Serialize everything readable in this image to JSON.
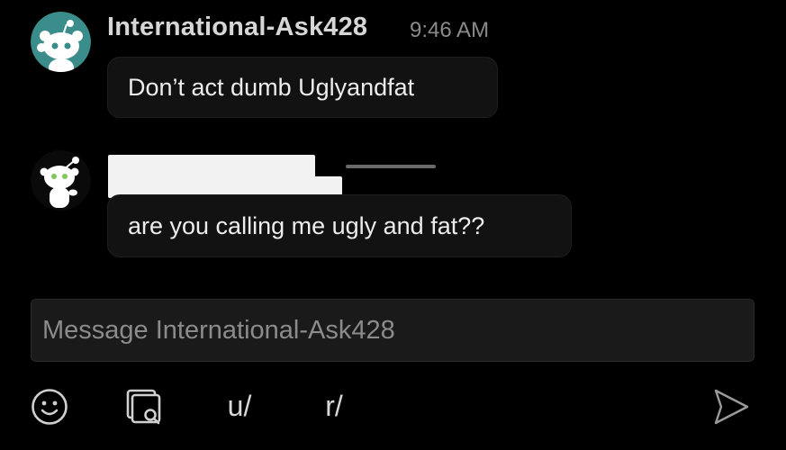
{
  "messages": [
    {
      "username": "International-Ask428",
      "time": "9:46 AM",
      "text": "Don’t act dumb Uglyandfat"
    },
    {
      "username": "",
      "time": "",
      "text": "are you calling me ugly and fat??"
    }
  ],
  "composer": {
    "placeholder": "Message International-Ask428"
  },
  "toolbar": {
    "user_mention_label": "u/",
    "community_mention_label": "r/"
  },
  "colors": {
    "background": "#000000",
    "bubble": "#121212",
    "composer": "#1a1a1a",
    "avatar_teal": "#3a8d8a",
    "avatar_black": "#0a0a0a"
  },
  "icons": {
    "emoji": "emoji-icon",
    "gallery": "gallery-search-icon",
    "send": "send-icon",
    "avatar": "snoo-avatar-icon"
  }
}
